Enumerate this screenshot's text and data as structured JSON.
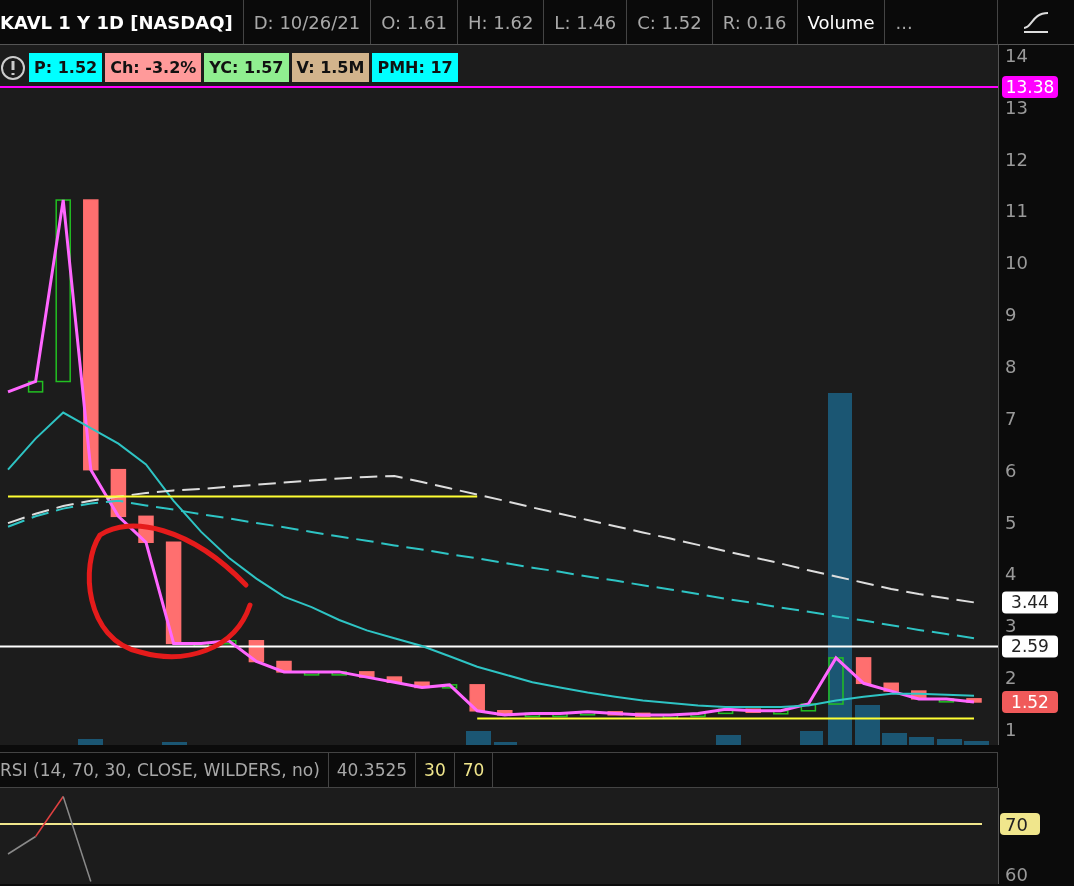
{
  "header": {
    "title": "KAVL 1 Y 1D [NASDAQ]",
    "fields": [
      "D: 10/26/21",
      "O: 1.61",
      "H: 1.62",
      "L: 1.46",
      "C: 1.52",
      "R: 0.16"
    ],
    "study": "Volume",
    "more": "..."
  },
  "badges": [
    {
      "text": "P: 1.52",
      "color": "#00ffff"
    },
    {
      "text": "Ch: -3.2%",
      "color": "#ff9a9a"
    },
    {
      "text": "YC: 1.57",
      "color": "#90ee90"
    },
    {
      "text": "V: 1.5M",
      "color": "#d2b48c"
    },
    {
      "text": "PMH: 17",
      "color": "#00ffff"
    }
  ],
  "price_chart": {
    "chart_data": {
      "type": "line",
      "ylim": [
        0.69,
        14.19
      ],
      "yticks": [
        1,
        2,
        3,
        4,
        5,
        6,
        7,
        8,
        9,
        10,
        11,
        12,
        13,
        14
      ],
      "series": [
        {
          "color": "#ff66ff",
          "values": [
            7.5,
            7.7,
            11.2,
            6.0,
            5.1,
            4.6,
            2.65,
            2.65,
            2.7,
            2.3,
            2.1,
            2.1,
            2.1,
            2.0,
            1.9,
            1.8,
            1.85,
            1.35,
            1.27,
            1.3,
            1.3,
            1.33,
            1.3,
            1.27,
            1.27,
            1.3,
            1.38,
            1.35,
            1.35,
            1.48,
            2.37,
            1.88,
            1.73,
            1.58,
            1.58,
            1.52
          ]
        },
        {
          "color": "#2ec4c4",
          "values": [
            6.0,
            6.6,
            7.1,
            6.8,
            6.5,
            6.1,
            5.4,
            4.8,
            4.3,
            3.9,
            3.55,
            3.35,
            3.1,
            2.9,
            2.75,
            2.6,
            2.4,
            2.2,
            2.05,
            1.9,
            1.8,
            1.7,
            1.62,
            1.55,
            1.5,
            1.45,
            1.42,
            1.42,
            1.42,
            1.45,
            1.55,
            1.62,
            1.68,
            1.68,
            1.66,
            1.64
          ]
        },
        {
          "color": "#2ec4c4",
          "line_style": "dashed",
          "values": [
            4.9,
            5.1,
            5.25,
            5.35,
            5.4,
            5.31,
            5.23,
            5.14,
            5.06,
            4.97,
            4.89,
            4.8,
            4.71,
            4.63,
            4.54,
            4.46,
            4.37,
            4.29,
            4.2,
            4.11,
            4.03,
            3.94,
            3.86,
            3.77,
            3.69,
            3.6,
            3.51,
            3.43,
            3.34,
            3.26,
            3.17,
            3.09,
            3.0,
            2.91,
            2.83,
            2.75
          ]
        },
        {
          "color": "#dddddd",
          "line_style": "dashed",
          "values": [
            4.97,
            5.15,
            5.3,
            5.4,
            5.48,
            5.55,
            5.6,
            5.63,
            5.67,
            5.71,
            5.75,
            5.79,
            5.83,
            5.86,
            5.88,
            5.76,
            5.64,
            5.52,
            5.4,
            5.27,
            5.15,
            5.03,
            4.91,
            4.79,
            4.67,
            4.55,
            4.43,
            4.31,
            4.19,
            4.06,
            3.94,
            3.82,
            3.7,
            3.6,
            3.52,
            3.44
          ]
        },
        {
          "color": "#ffff33",
          "values": [
            5.48,
            5.48,
            5.48,
            5.48,
            5.48,
            5.48,
            5.48,
            5.48,
            5.48,
            5.48,
            5.48,
            5.48,
            5.48,
            5.48,
            5.48,
            5.48,
            5.48,
            5.48,
            null,
            null,
            null,
            null,
            null,
            null,
            null,
            null,
            null,
            null,
            null,
            null,
            null,
            null,
            null,
            null,
            null,
            null
          ]
        },
        {
          "color": "#ffff33",
          "values": [
            null,
            null,
            null,
            null,
            null,
            null,
            null,
            null,
            null,
            null,
            null,
            null,
            null,
            null,
            null,
            null,
            null,
            1.2,
            1.2,
            1.2,
            1.2,
            1.2,
            1.2,
            1.2,
            1.2,
            1.2,
            1.2,
            1.2,
            1.2,
            1.2,
            1.2,
            1.2,
            1.2,
            1.2,
            1.2,
            1.2
          ]
        }
      ],
      "ref_lines": [
        {
          "axis": "y",
          "value": 13.38,
          "color": "#ff00ff",
          "label": "13.38"
        },
        {
          "axis": "y",
          "value": 2.59,
          "color": "#ffffff",
          "label": "2.59"
        }
      ],
      "annotations": [
        "3.44",
        "1.52"
      ]
    }
  },
  "rsi": {
    "title": "RSI (14, 70, 30, CLOSE, WILDERS, no)",
    "reading": "40.3525",
    "levels": [
      "30",
      "70"
    ],
    "chart_data": {
      "type": "line",
      "ylim": [
        58,
        77.2
      ],
      "yticks": [
        60,
        70
      ],
      "series": [
        {
          "color": "#8a8a8a",
          "values": [
            64,
            67.5,
            75.5,
            58.5,
            null,
            null,
            null,
            null,
            null,
            null,
            null,
            null,
            null,
            null,
            null,
            null,
            null,
            null,
            null,
            null,
            null,
            null,
            null,
            null,
            null,
            null,
            null,
            null,
            null,
            null,
            null,
            null,
            null,
            null,
            null,
            null
          ]
        }
      ],
      "ref_lines": [
        {
          "axis": "y",
          "value": 70,
          "color": "#f0e68c"
        }
      ]
    }
  }
}
